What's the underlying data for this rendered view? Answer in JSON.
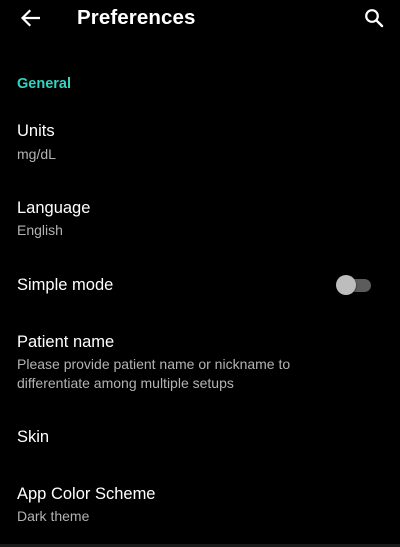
{
  "appbar": {
    "title": "Preferences",
    "back_icon": "arrow-back-icon",
    "search_icon": "search-icon"
  },
  "section": {
    "label": "General",
    "accent_color": "#2fd4c2"
  },
  "preferences": {
    "units": {
      "title": "Units",
      "summary": "mg/dL"
    },
    "language": {
      "title": "Language",
      "summary": "English"
    },
    "simple_mode": {
      "title": "Simple mode",
      "checked": false
    },
    "patient_name": {
      "title": "Patient name",
      "summary": "Please provide patient name or nickname to differentiate among multiple setups"
    },
    "skin": {
      "title": "Skin"
    },
    "app_color_scheme": {
      "title": "App Color Scheme",
      "summary": "Dark theme"
    }
  }
}
